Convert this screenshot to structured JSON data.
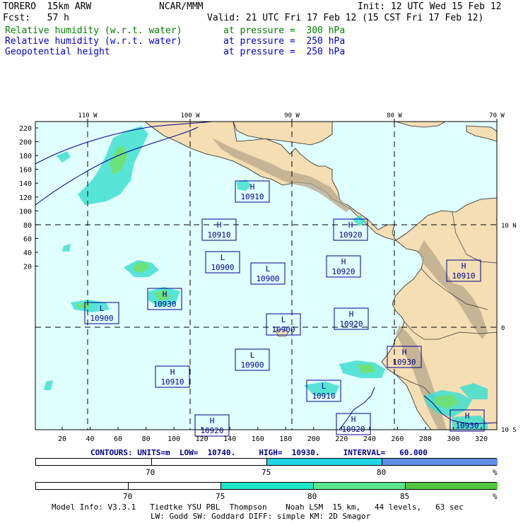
{
  "header": {
    "model": "TORERO  15km ARW",
    "center": "NCAR/MMM",
    "init": "Init: 12 UTC Wed 15 Feb 12",
    "fcst": "Fcst:   57 h",
    "valid": "Valid: 21 UTC Fri 17 Feb 12 (15 CST Fri 17 Feb 12)"
  },
  "fields": [
    {
      "name": "Relative humidity (w.r.t. water)",
      "pressure": "at pressure =  300 hPa",
      "color": "#008000"
    },
    {
      "name": "Relative humidity (w.r.t. water)",
      "pressure": "at pressure =  250 hPa",
      "color": "#0000cc"
    },
    {
      "name": "Geopotential height",
      "pressure": "at pressure =  250 hPa",
      "color": "#0000cc"
    }
  ],
  "map": {
    "colors": {
      "ocean": "#e0ffff",
      "land": "#f5deb3",
      "mountain": "#b5a58a",
      "rh_cyan": "#40e0d0",
      "rh_green": "#70e070",
      "grid": "#000000",
      "contour": "#00008b"
    },
    "top_labels": [
      "110 W",
      "100 W",
      "90 W",
      "80 W",
      "70 W"
    ],
    "right_labels": [
      "10 N",
      "0",
      "10 S"
    ],
    "left_ticks": [
      "220",
      "200",
      "180",
      "160",
      "140",
      "120",
      "100",
      "80",
      "60",
      "40",
      "20"
    ],
    "bottom_ticks": [
      "20",
      "40",
      "60",
      "80",
      "100",
      "120",
      "140",
      "160",
      "180",
      "200",
      "220",
      "240",
      "260",
      "280",
      "300",
      "320"
    ],
    "centers": [
      {
        "t": "H",
        "v": "10910"
      },
      {
        "t": "H",
        "v": "10910"
      },
      {
        "t": "H",
        "v": "10920"
      },
      {
        "t": "L",
        "v": "10900"
      },
      {
        "t": "L",
        "v": "10900"
      },
      {
        "t": "H",
        "v": "10920"
      },
      {
        "t": "H",
        "v": "10910"
      },
      {
        "t": "H",
        "v": "10930"
      },
      {
        "t": "L",
        "v": "10900"
      },
      {
        "t": "L",
        "v": "10900"
      },
      {
        "t": "H",
        "v": "10920"
      },
      {
        "t": "L",
        "v": "10900"
      },
      {
        "t": "H",
        "v": "10930"
      },
      {
        "t": "H",
        "v": "10910"
      },
      {
        "t": "L",
        "v": "10910"
      },
      {
        "t": "H",
        "v": "10920"
      },
      {
        "t": "H",
        "v": "10920"
      },
      {
        "t": "H",
        "v": "10930"
      }
    ]
  },
  "contours_line": {
    "text": "CONTOURS: UNITS=m  LOW=  10740.     HIGH=  10930.     INTERVAL=   60.000"
  },
  "colorbar1": {
    "labels": [
      "70",
      "75",
      "80",
      "%"
    ],
    "colors": [
      "#ffffff",
      "#1fd6e6",
      "#5f8fe6"
    ]
  },
  "colorbar2": {
    "labels": [
      "70",
      "75",
      "80",
      "85",
      "%"
    ],
    "colors": [
      "#ffffff",
      "#1fe6c8",
      "#59e68f",
      "#52c63f"
    ]
  },
  "footer": {
    "line1": "Model Info: V3.3.1   Tiedtke YSU PBL  Thompson    Noah LSM  15 km,   44 levels,   63 sec",
    "line2": "LW: Godd SW: Goddard DIFF: simple KM: 2D Smagor"
  }
}
